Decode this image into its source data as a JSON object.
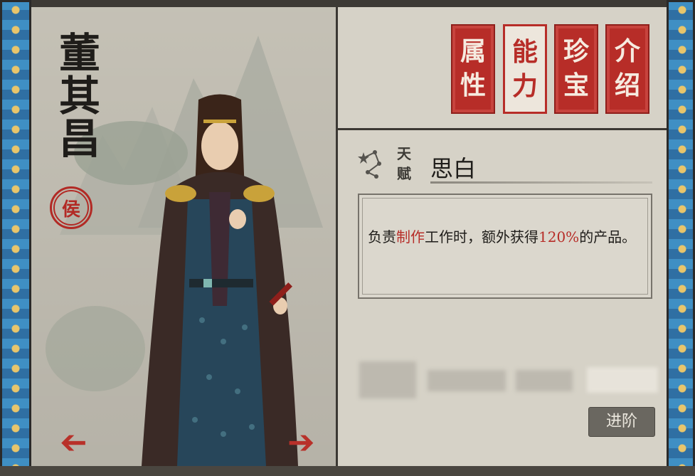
{
  "character": {
    "name": "董其昌",
    "rank": "侯"
  },
  "tabs": [
    {
      "label": "属性",
      "active": false
    },
    {
      "label": "能力",
      "active": true
    },
    {
      "label": "珍宝",
      "active": false
    },
    {
      "label": "介绍",
      "active": false
    }
  ],
  "talent": {
    "label": "天赋",
    "name": "思白",
    "icon": "constellation-icon",
    "description_parts": {
      "p1": "负责",
      "highlight1": "制作",
      "p2": "工作时，额外获得",
      "highlight2": "120%",
      "p3": "的产品。"
    }
  },
  "actions": {
    "advance_label": "进阶"
  },
  "nav": {
    "prev_icon": "left-arrow-icon",
    "next_icon": "right-arrow-icon"
  },
  "colors": {
    "accent_red": "#b72d28",
    "panel_bg": "#d6d2c7",
    "border_blue": "#3f8fc4"
  }
}
